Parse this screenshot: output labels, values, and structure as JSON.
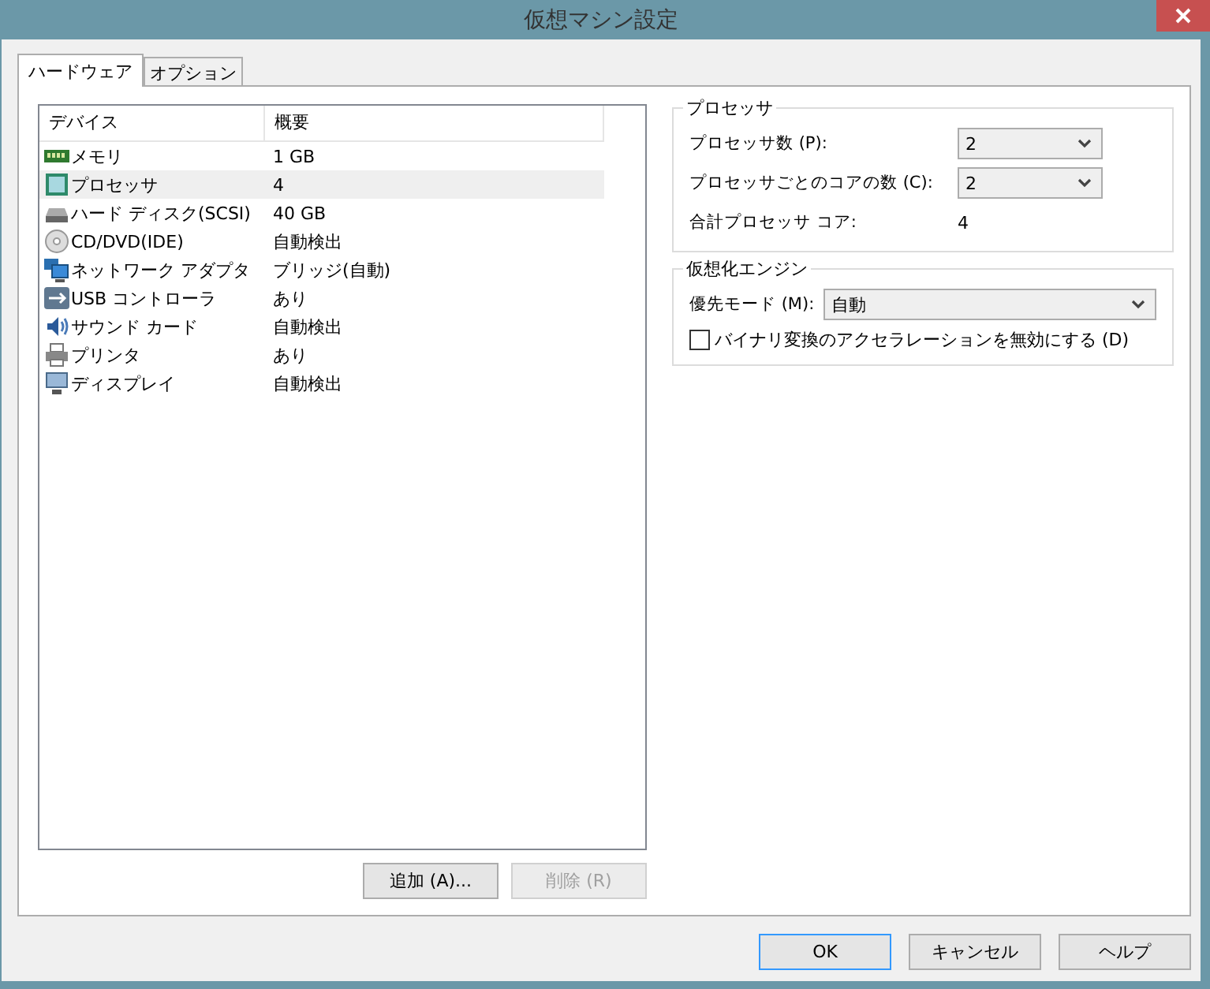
{
  "window": {
    "title": "仮想マシン設定"
  },
  "tabs": [
    {
      "label": "ハードウェア",
      "selected": true
    },
    {
      "label": "オプション",
      "selected": false
    }
  ],
  "device_list": {
    "columns": [
      "デバイス",
      "概要"
    ],
    "rows": [
      {
        "kind": "memory",
        "device": "メモリ",
        "summary": "1 GB",
        "selected": false
      },
      {
        "kind": "processor",
        "device": "プロセッサ",
        "summary": "4",
        "selected": true
      },
      {
        "kind": "disk",
        "device": "ハード ディスク(SCSI)",
        "summary": "40 GB",
        "selected": false
      },
      {
        "kind": "cdrom",
        "device": "CD/DVD(IDE)",
        "summary": "自動検出",
        "selected": false
      },
      {
        "kind": "network",
        "device": "ネットワーク アダプタ",
        "summary": "ブリッジ(自動)",
        "selected": false
      },
      {
        "kind": "usb",
        "device": "USB コントローラ",
        "summary": "あり",
        "selected": false
      },
      {
        "kind": "sound",
        "device": "サウンド カード",
        "summary": "自動検出",
        "selected": false
      },
      {
        "kind": "printer",
        "device": "プリンタ",
        "summary": "あり",
        "selected": false
      },
      {
        "kind": "display",
        "device": "ディスプレイ",
        "summary": "自動検出",
        "selected": false
      }
    ]
  },
  "list_buttons": [
    {
      "label": "追加 (A)...",
      "disabled": false
    },
    {
      "label": "削除 (R)",
      "disabled": true
    }
  ],
  "processor_group": {
    "title": "プロセッサ",
    "processor_count": {
      "label": "プロセッサ数 (P):",
      "value": "2"
    },
    "cores_per_processor": {
      "label": "プロセッサごとのコアの数 (C):",
      "value": "2"
    },
    "total": {
      "label": "合計プロセッサ コア:",
      "value": "4"
    }
  },
  "engine_group": {
    "title": "仮想化エンジン",
    "mode": {
      "label": "優先モード (M):",
      "value": "自動"
    },
    "disable_acceleration": {
      "label": "バイナリ変換のアクセラレーションを無効にする (D)",
      "checked": false
    }
  },
  "dialog_buttons": [
    {
      "label": "OK",
      "default": true
    },
    {
      "label": "キャンセル",
      "default": false
    },
    {
      "label": "ヘルプ",
      "default": false
    }
  ]
}
